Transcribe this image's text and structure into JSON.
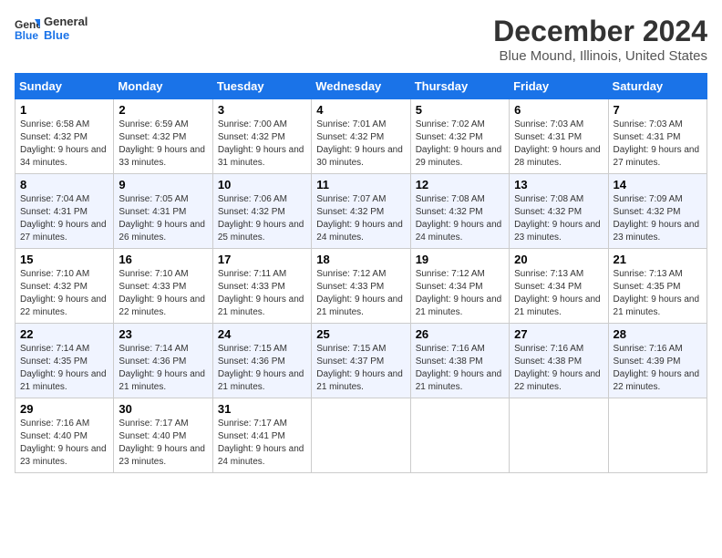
{
  "logo": {
    "text_general": "General",
    "text_blue": "Blue"
  },
  "title": {
    "month": "December 2024",
    "location": "Blue Mound, Illinois, United States"
  },
  "weekdays": [
    "Sunday",
    "Monday",
    "Tuesday",
    "Wednesday",
    "Thursday",
    "Friday",
    "Saturday"
  ],
  "weeks": [
    [
      {
        "day": "1",
        "sunrise": "6:58 AM",
        "sunset": "4:32 PM",
        "daylight": "9 hours and 34 minutes"
      },
      {
        "day": "2",
        "sunrise": "6:59 AM",
        "sunset": "4:32 PM",
        "daylight": "9 hours and 33 minutes"
      },
      {
        "day": "3",
        "sunrise": "7:00 AM",
        "sunset": "4:32 PM",
        "daylight": "9 hours and 31 minutes"
      },
      {
        "day": "4",
        "sunrise": "7:01 AM",
        "sunset": "4:32 PM",
        "daylight": "9 hours and 30 minutes"
      },
      {
        "day": "5",
        "sunrise": "7:02 AM",
        "sunset": "4:32 PM",
        "daylight": "9 hours and 29 minutes"
      },
      {
        "day": "6",
        "sunrise": "7:03 AM",
        "sunset": "4:31 PM",
        "daylight": "9 hours and 28 minutes"
      },
      {
        "day": "7",
        "sunrise": "7:03 AM",
        "sunset": "4:31 PM",
        "daylight": "9 hours and 27 minutes"
      }
    ],
    [
      {
        "day": "8",
        "sunrise": "7:04 AM",
        "sunset": "4:31 PM",
        "daylight": "9 hours and 27 minutes"
      },
      {
        "day": "9",
        "sunrise": "7:05 AM",
        "sunset": "4:31 PM",
        "daylight": "9 hours and 26 minutes"
      },
      {
        "day": "10",
        "sunrise": "7:06 AM",
        "sunset": "4:32 PM",
        "daylight": "9 hours and 25 minutes"
      },
      {
        "day": "11",
        "sunrise": "7:07 AM",
        "sunset": "4:32 PM",
        "daylight": "9 hours and 24 minutes"
      },
      {
        "day": "12",
        "sunrise": "7:08 AM",
        "sunset": "4:32 PM",
        "daylight": "9 hours and 24 minutes"
      },
      {
        "day": "13",
        "sunrise": "7:08 AM",
        "sunset": "4:32 PM",
        "daylight": "9 hours and 23 minutes"
      },
      {
        "day": "14",
        "sunrise": "7:09 AM",
        "sunset": "4:32 PM",
        "daylight": "9 hours and 23 minutes"
      }
    ],
    [
      {
        "day": "15",
        "sunrise": "7:10 AM",
        "sunset": "4:32 PM",
        "daylight": "9 hours and 22 minutes"
      },
      {
        "day": "16",
        "sunrise": "7:10 AM",
        "sunset": "4:33 PM",
        "daylight": "9 hours and 22 minutes"
      },
      {
        "day": "17",
        "sunrise": "7:11 AM",
        "sunset": "4:33 PM",
        "daylight": "9 hours and 21 minutes"
      },
      {
        "day": "18",
        "sunrise": "7:12 AM",
        "sunset": "4:33 PM",
        "daylight": "9 hours and 21 minutes"
      },
      {
        "day": "19",
        "sunrise": "7:12 AM",
        "sunset": "4:34 PM",
        "daylight": "9 hours and 21 minutes"
      },
      {
        "day": "20",
        "sunrise": "7:13 AM",
        "sunset": "4:34 PM",
        "daylight": "9 hours and 21 minutes"
      },
      {
        "day": "21",
        "sunrise": "7:13 AM",
        "sunset": "4:35 PM",
        "daylight": "9 hours and 21 minutes"
      }
    ],
    [
      {
        "day": "22",
        "sunrise": "7:14 AM",
        "sunset": "4:35 PM",
        "daylight": "9 hours and 21 minutes"
      },
      {
        "day": "23",
        "sunrise": "7:14 AM",
        "sunset": "4:36 PM",
        "daylight": "9 hours and 21 minutes"
      },
      {
        "day": "24",
        "sunrise": "7:15 AM",
        "sunset": "4:36 PM",
        "daylight": "9 hours and 21 minutes"
      },
      {
        "day": "25",
        "sunrise": "7:15 AM",
        "sunset": "4:37 PM",
        "daylight": "9 hours and 21 minutes"
      },
      {
        "day": "26",
        "sunrise": "7:16 AM",
        "sunset": "4:38 PM",
        "daylight": "9 hours and 21 minutes"
      },
      {
        "day": "27",
        "sunrise": "7:16 AM",
        "sunset": "4:38 PM",
        "daylight": "9 hours and 22 minutes"
      },
      {
        "day": "28",
        "sunrise": "7:16 AM",
        "sunset": "4:39 PM",
        "daylight": "9 hours and 22 minutes"
      }
    ],
    [
      {
        "day": "29",
        "sunrise": "7:16 AM",
        "sunset": "4:40 PM",
        "daylight": "9 hours and 23 minutes"
      },
      {
        "day": "30",
        "sunrise": "7:17 AM",
        "sunset": "4:40 PM",
        "daylight": "9 hours and 23 minutes"
      },
      {
        "day": "31",
        "sunrise": "7:17 AM",
        "sunset": "4:41 PM",
        "daylight": "9 hours and 24 minutes"
      },
      null,
      null,
      null,
      null
    ]
  ],
  "labels": {
    "sunrise": "Sunrise:",
    "sunset": "Sunset:",
    "daylight": "Daylight:"
  }
}
